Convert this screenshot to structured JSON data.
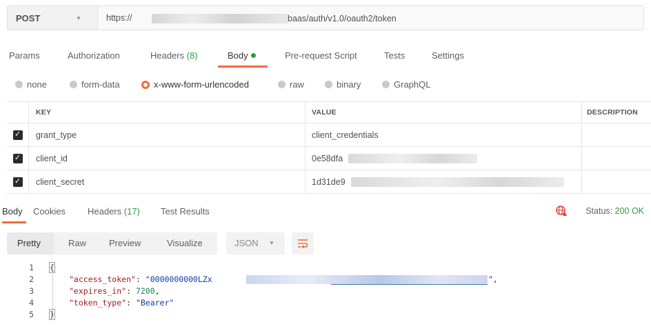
{
  "request": {
    "method": "POST",
    "url_prefix": "https://",
    "url_suffix": "baas/auth/v1.0/oauth2/token"
  },
  "request_tabs": {
    "params": "Params",
    "authorization": "Authorization",
    "headers": "Headers",
    "headers_count": "(8)",
    "body": "Body",
    "pre_request": "Pre-request Script",
    "tests": "Tests",
    "settings": "Settings"
  },
  "body_types": {
    "none": "none",
    "form_data": "form-data",
    "urlencoded": "x-www-form-urlencoded",
    "raw": "raw",
    "binary": "binary",
    "graphql": "GraphQL",
    "selected": "x-www-form-urlencoded"
  },
  "params_table": {
    "headers": {
      "key": "KEY",
      "value": "VALUE",
      "description": "DESCRIPTION"
    },
    "rows": [
      {
        "key": "grant_type",
        "value": "client_credentials",
        "checked": true
      },
      {
        "key": "client_id",
        "value": "0e58dfa",
        "checked": true
      },
      {
        "key": "client_secret",
        "value": "1d31de9",
        "checked": true
      }
    ]
  },
  "response_tabs": {
    "body": "Body",
    "cookies": "Cookies",
    "headers": "Headers",
    "headers_count": "(17)",
    "test_results": "Test Results",
    "status_label": "Status:",
    "status_value": "200 OK"
  },
  "response_toolbar": {
    "pretty": "Pretty",
    "raw": "Raw",
    "preview": "Preview",
    "visualize": "Visualize",
    "format": "JSON"
  },
  "response_code": {
    "line_numbers": [
      "1",
      "2",
      "3",
      "4",
      "5"
    ],
    "open_brace": "{",
    "close_brace": "}",
    "access_token_key": "\"access_token\"",
    "access_token_value_start": "\"0000000000LZx",
    "access_token_value_end": "\",",
    "expires_in_key": "\"expires_in\"",
    "expires_in_value": "7200",
    "token_type_key": "\"token_type\"",
    "token_type_value": "\"Bearer\""
  },
  "colors": {
    "accent": "#f26b3a",
    "success": "#2b9a4a",
    "json_key": "#a11d1d",
    "json_string": "#0d3aa8"
  }
}
